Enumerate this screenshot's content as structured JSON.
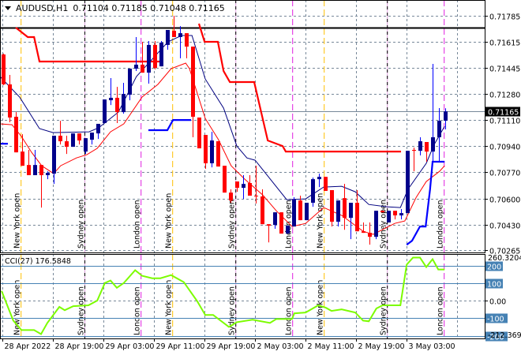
{
  "header": {
    "symbol": "AUDUSD,H1",
    "ohlc": "0.71104 0.71185 0.71048 0.71165"
  },
  "price_axis": {
    "labels": [
      "0.71785",
      "0.71615",
      "0.71445",
      "0.71280",
      "0.71110",
      "0.70940",
      "0.70770",
      "0.70600",
      "0.70430",
      "0.70265"
    ],
    "current": "0.71165"
  },
  "cci": {
    "title": "CCI(27) 176.5848",
    "max_label": "260.3204",
    "min_label": "-212.3697",
    "levels": [
      {
        "value": 200,
        "label": "200"
      },
      {
        "value": 100,
        "label": "100"
      },
      {
        "value": -100,
        "label": "-100"
      },
      {
        "value": -200,
        "label": "-200"
      }
    ],
    "zero_label": "0.00"
  },
  "time_axis": [
    "28 Apr 2022",
    "28 Apr 19:00",
    "29 Apr 03:00",
    "29 Apr 11:00",
    "29 Apr 19:00",
    "2 May 03:00",
    "2 May 11:00",
    "2 May 19:00",
    "3 May 03:00"
  ],
  "sessions": [
    {
      "label": "New York open",
      "type": "ny",
      "bar": 2.9
    },
    {
      "label": "Sydney open",
      "type": "sydney",
      "bar": 13
    },
    {
      "label": "London open",
      "type": "london",
      "bar": 21.9
    },
    {
      "label": "New York open",
      "type": "ny",
      "bar": 26.9
    },
    {
      "label": "Sydney open",
      "type": "sydney",
      "bar": 36.9
    },
    {
      "label": "London open",
      "type": "london",
      "bar": 45.9
    },
    {
      "label": "New York open",
      "type": "ny",
      "bar": 50.9
    },
    {
      "label": "Sydney open",
      "type": "sydney",
      "bar": 60.9
    },
    {
      "label": "London open",
      "type": "london",
      "bar": 69.9
    }
  ],
  "colors": {
    "bull": "#00008b",
    "bull_wick": "#0000ff",
    "bear": "#ff0000",
    "ma_fast": "#ff0000",
    "ma_slow": "#000080",
    "trail_upper": "#ff0000",
    "trail_lower": "#0000ff",
    "cci": "#7cfc00",
    "level": "#4682b4",
    "ny": "#ffc000",
    "london": "#e020e0",
    "sydney": "#dda0dd"
  },
  "chart_data": {
    "type": "candlestick",
    "symbol": "AUDUSD",
    "timeframe": "H1",
    "ylim": [
      0.70265,
      0.71785
    ],
    "resistance_line": 0.71708,
    "candles": [
      [
        0.71534,
        0.7154,
        0.71335,
        0.7134
      ],
      [
        0.7134,
        0.71401,
        0.71094,
        0.71125
      ],
      [
        0.7113,
        0.7116,
        0.70899,
        0.70899
      ],
      [
        0.70904,
        0.71017,
        0.70812,
        0.70812
      ],
      [
        0.70817,
        0.70915,
        0.70751,
        0.70751
      ],
      [
        0.70751,
        0.70915,
        0.70751,
        0.70817
      ],
      [
        0.70817,
        0.70817,
        0.70541,
        0.70751
      ],
      [
        0.70751,
        0.70776,
        0.70725,
        0.70766
      ],
      [
        0.70761,
        0.71007,
        0.70694,
        0.71007
      ],
      [
        0.71007,
        0.71104,
        0.7095,
        0.70971
      ],
      [
        0.70971,
        0.71007,
        0.70889,
        0.70935
      ],
      [
        0.70935,
        0.71022,
        0.70935,
        0.71022
      ],
      [
        0.71022,
        0.71022,
        0.7095,
        0.70976
      ],
      [
        0.70904,
        0.70991,
        0.70889,
        0.70991
      ],
      [
        0.70981,
        0.71027,
        0.7095,
        0.71027
      ],
      [
        0.71022,
        0.71084,
        0.70986,
        0.71084
      ],
      [
        0.71089,
        0.71242,
        0.71089,
        0.71242
      ],
      [
        0.71237,
        0.71381,
        0.71206,
        0.71253
      ],
      [
        0.71253,
        0.71324,
        0.71089,
        0.7116
      ],
      [
        0.7116,
        0.7135,
        0.7115,
        0.71278
      ],
      [
        0.71273,
        0.71442,
        0.71237,
        0.71442
      ],
      [
        0.71442,
        0.71647,
        0.71427,
        0.71468
      ],
      [
        0.71468,
        0.71616,
        0.71416,
        0.71416
      ],
      [
        0.71416,
        0.71621,
        0.71345,
        0.71596
      ],
      [
        0.71596,
        0.71621,
        0.71437,
        0.71447
      ],
      [
        0.71457,
        0.71621,
        0.71457,
        0.71611
      ],
      [
        0.71596,
        0.71693,
        0.71565,
        0.71693
      ],
      [
        0.71688,
        0.71785,
        0.71647,
        0.71647
      ],
      [
        0.71647,
        0.71718,
        0.71509,
        0.71672
      ],
      [
        0.71672,
        0.71672,
        0.71509,
        0.71585
      ],
      [
        0.71585,
        0.71585,
        0.70997,
        0.7113
      ],
      [
        0.71125,
        0.71125,
        0.70925,
        0.70925
      ],
      [
        0.71012,
        0.71012,
        0.70792,
        0.70828
      ],
      [
        0.70828,
        0.71032,
        0.70802,
        0.70976
      ],
      [
        0.70971,
        0.70971,
        0.70807,
        0.70807
      ],
      [
        0.70812,
        0.70812,
        0.70638,
        0.70638
      ],
      [
        0.70638,
        0.70659,
        0.70572,
        0.70587
      ],
      [
        0.7071,
        0.7071,
        0.70643,
        0.70669
      ],
      [
        0.70669,
        0.70751,
        0.70597,
        0.70694
      ],
      [
        0.707,
        0.70751,
        0.70618,
        0.70618
      ],
      [
        0.70618,
        0.70812,
        0.70567,
        0.70613
      ],
      [
        0.70613,
        0.70659,
        0.70433,
        0.70433
      ],
      [
        0.70433,
        0.70433,
        0.70315,
        0.70423
      ],
      [
        0.70428,
        0.7051,
        0.70403,
        0.7051
      ],
      [
        0.7051,
        0.7051,
        0.70372,
        0.70372
      ],
      [
        0.70372,
        0.70423,
        0.70372,
        0.70423
      ],
      [
        0.70418,
        0.70608,
        0.70418,
        0.70592
      ],
      [
        0.70587,
        0.70618,
        0.70459,
        0.70459
      ],
      [
        0.70459,
        0.70572,
        0.70459,
        0.70572
      ],
      [
        0.70572,
        0.70735,
        0.70546,
        0.70725
      ],
      [
        0.70725,
        0.70761,
        0.70674,
        0.7074
      ],
      [
        0.7074,
        0.7074,
        0.70649,
        0.70649
      ],
      [
        0.70654,
        0.70654,
        0.70418,
        0.70449
      ],
      [
        0.70449,
        0.70587,
        0.70418,
        0.70587
      ],
      [
        0.70602,
        0.70694,
        0.70397,
        0.70474
      ],
      [
        0.70474,
        0.70572,
        0.70336,
        0.70572
      ],
      [
        0.70572,
        0.70654,
        0.70387,
        0.70387
      ],
      [
        0.70387,
        0.70444,
        0.70377,
        0.70377
      ],
      [
        0.70377,
        0.70444,
        0.703,
        0.70351
      ],
      [
        0.70351,
        0.7052,
        0.70336,
        0.7052
      ],
      [
        0.7052,
        0.7052,
        0.7051,
        0.7051
      ],
      [
        0.70444,
        0.7052,
        0.70444,
        0.7052
      ],
      [
        0.7052,
        0.7052,
        0.70464,
        0.7049
      ],
      [
        0.7049,
        0.70531,
        0.70464,
        0.70505
      ],
      [
        0.70505,
        0.70909,
        0.70505,
        0.70909
      ],
      [
        0.70915,
        0.7093,
        0.70776,
        0.70909
      ],
      [
        0.70909,
        0.70997,
        0.70879,
        0.70971
      ],
      [
        0.70966,
        0.70966,
        0.70838,
        0.70904
      ],
      [
        0.70904,
        0.71473,
        0.70838,
        0.70997
      ],
      [
        0.70997,
        0.71186,
        0.70838,
        0.71104
      ],
      [
        0.71104,
        0.71185,
        0.71048,
        0.71165
      ]
    ],
    "ma_slow": [
      [
        -0.5,
        0.71391
      ],
      [
        2.6,
        0.71258
      ],
      [
        5.75,
        0.71053
      ],
      [
        7.9,
        0.71027
      ],
      [
        13.6,
        0.71032
      ],
      [
        15.1,
        0.71058
      ],
      [
        18.25,
        0.7116
      ],
      [
        21.1,
        0.71391
      ],
      [
        23.6,
        0.71503
      ],
      [
        26.1,
        0.71616
      ],
      [
        28.25,
        0.71657
      ],
      [
        29.9,
        0.71657
      ],
      [
        32,
        0.71375
      ],
      [
        34.9,
        0.71186
      ],
      [
        37,
        0.7094
      ],
      [
        38.6,
        0.70863
      ],
      [
        39.9,
        0.70848
      ],
      [
        41.6,
        0.70761
      ],
      [
        44.9,
        0.70592
      ],
      [
        47.9,
        0.70597
      ],
      [
        50.75,
        0.70674
      ],
      [
        53.6,
        0.70679
      ],
      [
        55.75,
        0.70643
      ],
      [
        57.9,
        0.70561
      ],
      [
        60.75,
        0.70546
      ],
      [
        62.9,
        0.70541
      ],
      [
        64.1,
        0.70659
      ],
      [
        67,
        0.70828
      ],
      [
        68.25,
        0.7095
      ],
      [
        69.9,
        0.71068
      ]
    ],
    "ma_fast": [
      [
        -0.5,
        0.71084
      ],
      [
        1.4,
        0.71078
      ],
      [
        2.9,
        0.71002
      ],
      [
        4.5,
        0.70899
      ],
      [
        6.1,
        0.70812
      ],
      [
        8,
        0.70761
      ],
      [
        9.1,
        0.70812
      ],
      [
        11.6,
        0.70863
      ],
      [
        13.25,
        0.70884
      ],
      [
        14.9,
        0.70925
      ],
      [
        17,
        0.71032
      ],
      [
        19.1,
        0.71084
      ],
      [
        22,
        0.71258
      ],
      [
        24.5,
        0.7134
      ],
      [
        26.6,
        0.71442
      ],
      [
        28.9,
        0.71478
      ],
      [
        29.5,
        0.71442
      ],
      [
        32,
        0.71119
      ],
      [
        34.1,
        0.70981
      ],
      [
        36.1,
        0.70812
      ],
      [
        38.25,
        0.70725
      ],
      [
        41.1,
        0.70623
      ],
      [
        43.25,
        0.7052
      ],
      [
        45.75,
        0.70418
      ],
      [
        47.9,
        0.70438
      ],
      [
        50.75,
        0.70541
      ],
      [
        53.6,
        0.7049
      ],
      [
        57,
        0.70387
      ],
      [
        58.6,
        0.70367
      ],
      [
        62,
        0.70438
      ],
      [
        63.6,
        0.70454
      ],
      [
        65.4,
        0.70607
      ],
      [
        67,
        0.7071
      ],
      [
        69.1,
        0.70776
      ],
      [
        69.9,
        0.70812
      ]
    ],
    "trail_upper": [
      [
        [
          2,
          0.71708
        ],
        [
          3.9,
          0.71647
        ],
        [
          4.9,
          0.71647
        ],
        [
          5.75,
          0.71488
        ],
        [
          25.1,
          0.71488
        ]
      ],
      [
        [
          31,
          0.71734
        ],
        [
          31.9,
          0.71616
        ],
        [
          34,
          0.71616
        ],
        [
          34.9,
          0.71427
        ],
        [
          35.9,
          0.71355
        ],
        [
          39.75,
          0.71355
        ],
        [
          41.9,
          0.70976
        ],
        [
          44.25,
          0.7094
        ],
        [
          44.75,
          0.70904
        ],
        [
          63,
          0.70904
        ]
      ]
    ],
    "trail_lower": [
      [
        [
          -0.5,
          0.70955
        ],
        [
          0.75,
          0.70955
        ]
      ],
      [
        [
          23,
          0.71043
        ],
        [
          26,
          0.71043
        ],
        [
          26.9,
          0.71109
        ],
        [
          29.75,
          0.71109
        ]
      ],
      [
        [
          63.9,
          0.703
        ],
        [
          64.75,
          0.70326
        ],
        [
          66,
          0.70418
        ],
        [
          66.9,
          0.70418
        ],
        [
          67.6,
          0.70659
        ],
        [
          68,
          0.70838
        ],
        [
          69.9,
          0.70838
        ]
      ]
    ],
    "cci_series": [
      [
        -0.25,
        55
      ],
      [
        1.6,
        -114
      ],
      [
        2.9,
        -168
      ],
      [
        4.9,
        -168
      ],
      [
        6,
        -191
      ],
      [
        7,
        -127
      ],
      [
        8.9,
        -36
      ],
      [
        9.75,
        -55
      ],
      [
        11.1,
        -32
      ],
      [
        13.5,
        -27
      ],
      [
        14.9,
        0
      ],
      [
        16.1,
        100
      ],
      [
        17,
        114
      ],
      [
        18,
        73
      ],
      [
        19.1,
        100
      ],
      [
        20.9,
        173
      ],
      [
        22,
        141
      ],
      [
        23.6,
        127
      ],
      [
        24.9,
        127
      ],
      [
        26.6,
        145
      ],
      [
        28.6,
        105
      ],
      [
        30.75,
        -5
      ],
      [
        32,
        -82
      ],
      [
        33.25,
        -82
      ],
      [
        35.75,
        -150
      ],
      [
        37,
        -123
      ],
      [
        39.5,
        -109
      ],
      [
        42.25,
        -127
      ],
      [
        43.25,
        -105
      ],
      [
        45.75,
        -105
      ],
      [
        46.1,
        -73
      ],
      [
        47.9,
        -68
      ],
      [
        49.9,
        -27
      ],
      [
        51.1,
        -41
      ],
      [
        52,
        -59
      ],
      [
        53.6,
        -50
      ],
      [
        55.75,
        -68
      ],
      [
        57,
        -114
      ],
      [
        57.9,
        -118
      ],
      [
        59.1,
        -45
      ],
      [
        60.1,
        -27
      ],
      [
        62.9,
        -27
      ],
      [
        63.9,
        205
      ],
      [
        64.9,
        245
      ],
      [
        66,
        245
      ],
      [
        67,
        191
      ],
      [
        68,
        236
      ],
      [
        68.9,
        177
      ],
      [
        69.9,
        177
      ]
    ],
    "cci_ylim": [
      -212.3697,
      260.3204
    ]
  }
}
